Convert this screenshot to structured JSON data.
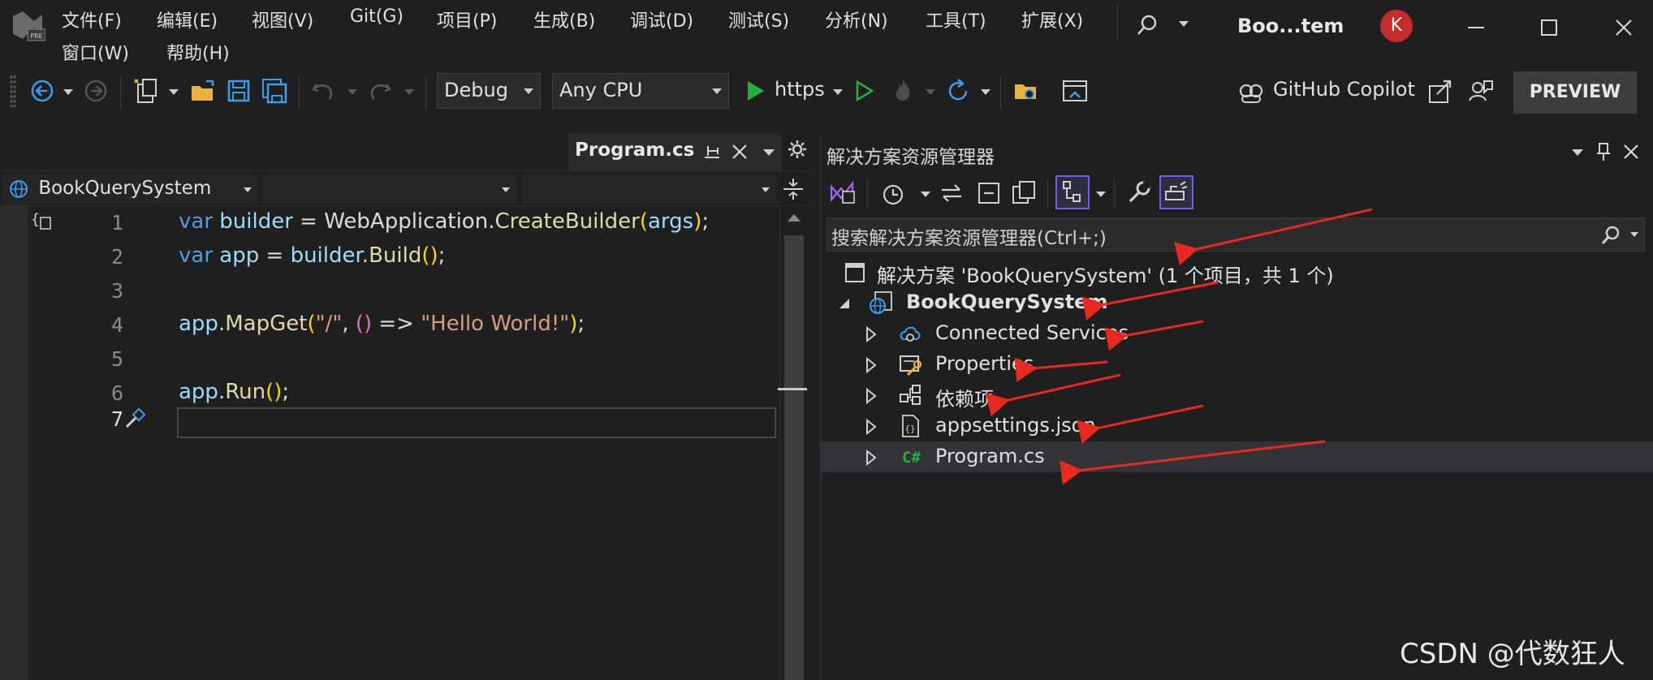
{
  "window": {
    "title": "Boo...tem",
    "avatar_initial": "K",
    "logo_badge": "PRE"
  },
  "menu": {
    "row1": [
      "文件(F)",
      "编辑(E)",
      "视图(V)",
      "Git(G)",
      "项目(P)",
      "生成(B)",
      "调试(D)",
      "测试(S)",
      "分析(N)",
      "工具(T)",
      "扩展(X)"
    ],
    "row2": [
      "窗口(W)",
      "帮助(H)"
    ]
  },
  "toolbar": {
    "configuration": "Debug",
    "platform": "Any CPU",
    "run_target": "https",
    "copilot_label": "GitHub Copilot",
    "preview_label": "PREVIEW",
    "spellcheck_glyph": "abc"
  },
  "editor": {
    "tab_label": "Program.cs",
    "nav_project": "BookQuerySystem",
    "nav_type": "",
    "nav_member": "",
    "current_line": 7,
    "lines": [
      {
        "num": "1",
        "tokens": [
          {
            "c": "kw",
            "t": "var "
          },
          {
            "c": "var",
            "t": "builder"
          },
          {
            "c": "pln",
            "t": " = "
          },
          {
            "c": "typ",
            "t": "WebApplication"
          },
          {
            "c": "pln",
            "t": "."
          },
          {
            "c": "mth",
            "t": "CreateBuilder"
          },
          {
            "c": "par",
            "t": "("
          },
          {
            "c": "var",
            "t": "args"
          },
          {
            "c": "par",
            "t": ")"
          },
          {
            "c": "pln",
            "t": ";"
          }
        ]
      },
      {
        "num": "2",
        "tokens": [
          {
            "c": "kw",
            "t": "var "
          },
          {
            "c": "var",
            "t": "app"
          },
          {
            "c": "pln",
            "t": " = "
          },
          {
            "c": "var",
            "t": "builder"
          },
          {
            "c": "pln",
            "t": "."
          },
          {
            "c": "mth",
            "t": "Build"
          },
          {
            "c": "par",
            "t": "()"
          },
          {
            "c": "pln",
            "t": ";"
          }
        ]
      },
      {
        "num": "3",
        "tokens": []
      },
      {
        "num": "4",
        "tokens": [
          {
            "c": "var",
            "t": "app"
          },
          {
            "c": "pln",
            "t": "."
          },
          {
            "c": "mth",
            "t": "MapGet"
          },
          {
            "c": "par",
            "t": "("
          },
          {
            "c": "str",
            "t": "\"/\""
          },
          {
            "c": "pln",
            "t": ", "
          },
          {
            "c": "par2",
            "t": "()"
          },
          {
            "c": "pln",
            "t": " => "
          },
          {
            "c": "str",
            "t": "\"Hello World!\""
          },
          {
            "c": "par",
            "t": ")"
          },
          {
            "c": "pln",
            "t": ";"
          }
        ]
      },
      {
        "num": "5",
        "tokens": []
      },
      {
        "num": "6",
        "tokens": [
          {
            "c": "var",
            "t": "app"
          },
          {
            "c": "pln",
            "t": "."
          },
          {
            "c": "mth",
            "t": "Run"
          },
          {
            "c": "par",
            "t": "()"
          },
          {
            "c": "pln",
            "t": ";"
          }
        ]
      },
      {
        "num": "7",
        "tokens": []
      }
    ]
  },
  "solution_explorer": {
    "title": "解决方案资源管理器",
    "search_placeholder": "搜索解决方案资源管理器(Ctrl+;)",
    "solution_label": "解决方案 'BookQuerySystem' (1 个项目，共 1 个)",
    "project_label": "BookQuerySystem",
    "items": [
      {
        "label": "Connected Services",
        "icon": "connected-services-icon"
      },
      {
        "label": "Properties",
        "icon": "properties-icon"
      },
      {
        "label": "依赖项",
        "icon": "dependencies-icon"
      },
      {
        "label": "appsettings.json",
        "icon": "json-file-icon"
      },
      {
        "label": "Program.cs",
        "icon": "csharp-file-icon"
      }
    ],
    "csharp_badge": "C#",
    "json_badge": "{}"
  },
  "watermark": "CSDN @代数狂人",
  "colors": {
    "background": "#1f1f1f",
    "accent_purple": "#7160e8",
    "run_green": "#27ae3c",
    "annotation_red": "#e8291f",
    "avatar_red": "#c42b2b"
  }
}
